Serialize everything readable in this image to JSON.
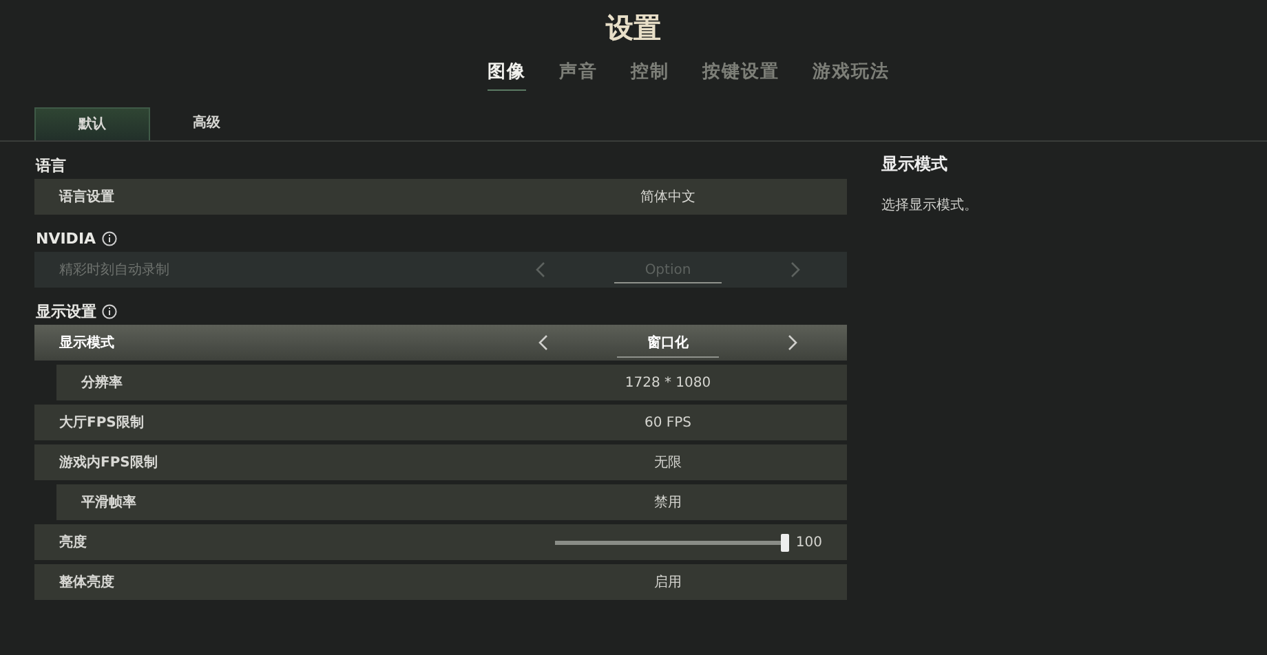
{
  "title": "设置",
  "tabs": [
    {
      "label": "图像",
      "selected": true
    },
    {
      "label": "声音",
      "selected": false
    },
    {
      "label": "控制",
      "selected": false
    },
    {
      "label": "按键设置",
      "selected": false
    },
    {
      "label": "游戏玩法",
      "selected": false
    }
  ],
  "subtabs": [
    {
      "label": "默认",
      "selected": true
    },
    {
      "label": "高级",
      "selected": false
    }
  ],
  "sections": [
    {
      "heading": "语言",
      "info": false,
      "rows": [
        {
          "kind": "select",
          "label": "语言设置",
          "value": "简体中文",
          "indented": false,
          "disabled": false,
          "selected": false
        }
      ]
    },
    {
      "heading": "NVIDIA",
      "info": true,
      "rows": [
        {
          "kind": "arrows",
          "label": "精彩时刻自动录制",
          "value": "Option",
          "indented": false,
          "disabled": true,
          "selected": false
        }
      ]
    },
    {
      "heading": "显示设置",
      "info": true,
      "rows": [
        {
          "kind": "arrows",
          "label": "显示模式",
          "value": "窗口化",
          "indented": false,
          "disabled": false,
          "selected": true
        },
        {
          "kind": "select",
          "label": "分辨率",
          "value": "1728 * 1080",
          "indented": true,
          "disabled": false,
          "selected": false
        },
        {
          "kind": "select",
          "label": "大厅FPS限制",
          "value": "60 FPS",
          "indented": false,
          "disabled": false,
          "selected": false
        },
        {
          "kind": "select",
          "label": "游戏内FPS限制",
          "value": "无限",
          "indented": false,
          "disabled": false,
          "selected": false
        },
        {
          "kind": "select",
          "label": "平滑帧率",
          "value": "禁用",
          "indented": true,
          "disabled": false,
          "selected": false
        },
        {
          "kind": "slider",
          "label": "亮度",
          "value": "100",
          "level": 1,
          "indented": false,
          "disabled": false,
          "selected": false
        },
        {
          "kind": "select",
          "label": "整体亮度",
          "value": "启用",
          "indented": false,
          "disabled": false,
          "selected": false
        }
      ]
    }
  ],
  "details": {
    "title": "显示模式",
    "description": "选择显示模式。"
  }
}
